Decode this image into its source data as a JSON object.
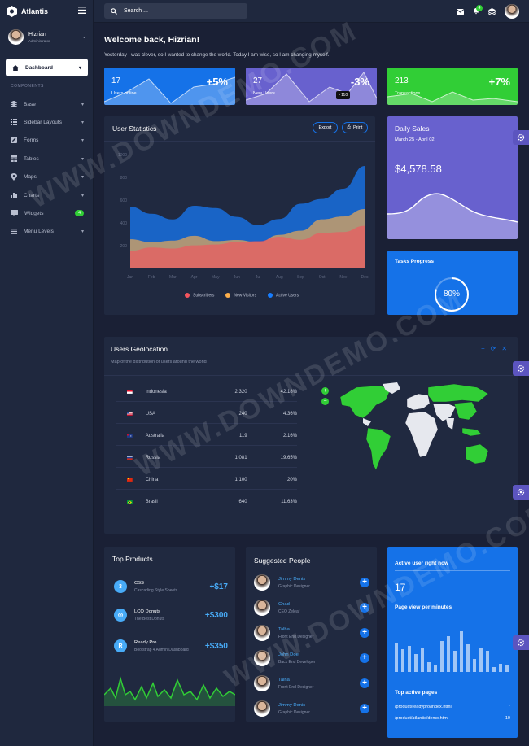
{
  "app": {
    "brand": "Atlantis"
  },
  "search": {
    "placeholder": "Search ..."
  },
  "notifications": {
    "count": "4"
  },
  "user": {
    "name": "Hizrian",
    "role": "Administrator"
  },
  "sidebar": {
    "active": "Dashboard",
    "section": "COMPONENTS",
    "items": [
      {
        "label": "Base"
      },
      {
        "label": "Sidebar Layouts"
      },
      {
        "label": "Forms"
      },
      {
        "label": "Tables"
      },
      {
        "label": "Maps"
      },
      {
        "label": "Charts"
      },
      {
        "label": "Widgets",
        "badge": "4"
      },
      {
        "label": "Menu Levels"
      }
    ]
  },
  "welcome": {
    "title": "Welcome back, Hizrian!",
    "subtitle": "Yesterday I was clever, so I wanted to change the world. Today I am wise, so I am changing myself."
  },
  "stats": [
    {
      "value": "17",
      "percent": "+5%",
      "label": "Users online",
      "color": "#1572e8"
    },
    {
      "value": "27",
      "percent": "-3%",
      "label": "New Users",
      "tooltip": "• 110",
      "color": "#6861ce"
    },
    {
      "value": "213",
      "percent": "+7%",
      "label": "Transactions",
      "color": "#31ce36"
    }
  ],
  "user_stats": {
    "title": "User Statistics",
    "export": "Export",
    "print": "Print",
    "chart_data": {
      "type": "area",
      "categories": [
        "Jan",
        "Feb",
        "Mar",
        "Apr",
        "May",
        "Jun",
        "Jul",
        "Aug",
        "Sep",
        "Oct",
        "Nov",
        "Dec"
      ],
      "y_ticks": [
        "1000",
        "800",
        "600",
        "400",
        "200"
      ],
      "ylim": [
        0,
        1000
      ],
      "series": [
        {
          "name": "Subscribers",
          "color": "#f3545d",
          "values": [
            154,
            184,
            175,
            203,
            210,
            231,
            240,
            278,
            252,
            312,
            320,
            374
          ]
        },
        {
          "name": "New Visitors",
          "color": "#fdaf4b",
          "values": [
            256,
            230,
            245,
            287,
            240,
            250,
            230,
            295,
            331,
            431,
            456,
            521
          ]
        },
        {
          "name": "Active Users",
          "color": "#177dff",
          "values": [
            542,
            480,
            430,
            550,
            530,
            453,
            380,
            434,
            568,
            610,
            700,
            900
          ]
        }
      ]
    }
  },
  "daily_sales": {
    "title": "Daily Sales",
    "range": "March 25 - April 02",
    "amount": "$4,578.58"
  },
  "tasks": {
    "title": "Tasks Progress",
    "value": "80%"
  },
  "geo": {
    "title": "Users Geolocation",
    "subtitle": "Map of the distribution of users around the world",
    "rows": [
      {
        "country": "Indonesia",
        "users": "2.320",
        "pct": "42.18%",
        "flag": "id"
      },
      {
        "country": "USA",
        "users": "240",
        "pct": "4.36%",
        "flag": "us"
      },
      {
        "country": "Australia",
        "users": "119",
        "pct": "2.16%",
        "flag": "au"
      },
      {
        "country": "Russia",
        "users": "1.081",
        "pct": "19.65%",
        "flag": "ru"
      },
      {
        "country": "China",
        "users": "1.100",
        "pct": "20%",
        "flag": "cn"
      },
      {
        "country": "Brasil",
        "users": "640",
        "pct": "11.63%",
        "flag": "br"
      }
    ]
  },
  "top_products": {
    "title": "Top Products",
    "items": [
      {
        "icon": "CSS",
        "name": "CSS",
        "desc": "Cascading Style Sheets",
        "price": "+$17"
      },
      {
        "icon": "LCO",
        "name": "LCO Donuts",
        "desc": "The Best Donuts",
        "price": "+$300"
      },
      {
        "icon": "R",
        "name": "Ready Pro",
        "desc": "Bootstrap 4 Admin Dashboard",
        "price": "+$350"
      }
    ]
  },
  "suggested": {
    "title": "Suggested People",
    "items": [
      {
        "name": "Jimmy Denis",
        "role": "Graphic Designer"
      },
      {
        "name": "Chad",
        "role": "CEO Zeleaf"
      },
      {
        "name": "Talha",
        "role": "Front End Designer"
      },
      {
        "name": "John Doe",
        "role": "Back End Developer"
      },
      {
        "name": "Talha",
        "role": "Front End Designer"
      },
      {
        "name": "Jimmy Denis",
        "role": "Graphic Designer"
      }
    ]
  },
  "active_users": {
    "title": "Active user right now",
    "value": "17",
    "pageview": "Page view per minutes",
    "pages_title": "Top active pages",
    "pages": [
      {
        "path": "/product/readypro/index.html",
        "count": "7"
      },
      {
        "path": "/product/atlantis/demo.html",
        "count": "10"
      }
    ]
  },
  "watermark": "WWW.DOWNDEMO.COM"
}
